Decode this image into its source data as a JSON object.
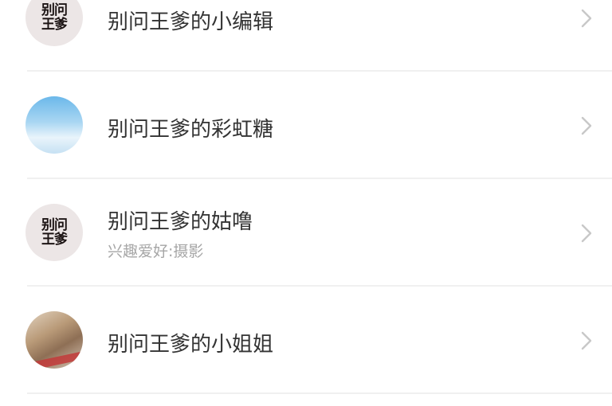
{
  "items": [
    {
      "title": "别问王爹的小编辑",
      "subtitle": "",
      "avatar": "text-logo",
      "avatar_lines": [
        "别问",
        "王爹"
      ]
    },
    {
      "title": "别问王爹的彩虹糖",
      "subtitle": "",
      "avatar": "sky-photo",
      "avatar_lines": []
    },
    {
      "title": "别问王爹的姑噜",
      "subtitle": "兴趣爱好:摄影",
      "avatar": "text-logo",
      "avatar_lines": [
        "别问",
        "王爹"
      ]
    },
    {
      "title": "别问王爹的小姐姐",
      "subtitle": "",
      "avatar": "person-photo",
      "avatar_lines": []
    }
  ],
  "icons": {
    "chevron": "chevron-right-icon"
  },
  "colors": {
    "title": "#333333",
    "subtitle": "#a6a6a6",
    "divider": "#f0f0f0",
    "chevron": "#c8c8c8"
  }
}
